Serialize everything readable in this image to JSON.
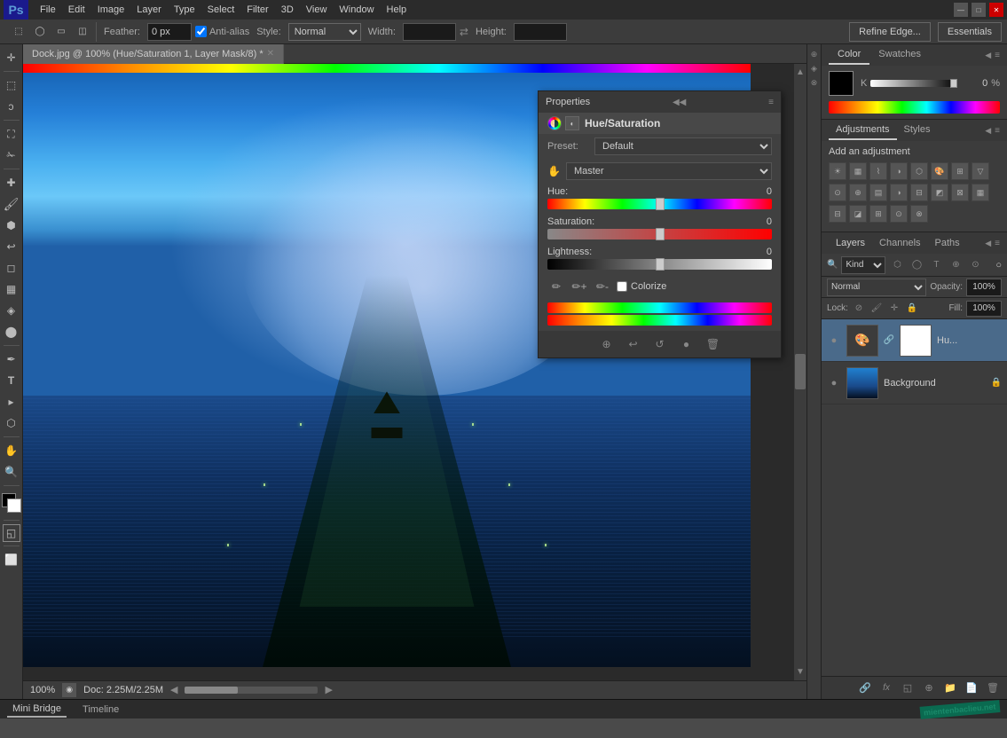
{
  "app": {
    "title": "Adobe Photoshop",
    "logo": "Ps",
    "workspace": "Essentials"
  },
  "menu": {
    "items": [
      "File",
      "Edit",
      "Image",
      "Layer",
      "Type",
      "Select",
      "Filter",
      "3D",
      "View",
      "Window",
      "Help"
    ]
  },
  "toolbar": {
    "feather_label": "Feather:",
    "feather_value": "0 px",
    "anti_alias_label": "Anti-alias",
    "style_label": "Style:",
    "style_value": "Normal",
    "width_label": "Width:",
    "height_label": "Height:",
    "refine_edge": "Refine Edge...",
    "essentials": "Essentials"
  },
  "canvas": {
    "tab_title": "Dock.jpg @ 100% (Hue/Saturation 1, Layer Mask/8) *"
  },
  "properties_panel": {
    "title": "Properties",
    "panel_title": "Hue/Saturation",
    "preset_label": "Preset:",
    "preset_value": "Default",
    "channel_value": "Master",
    "hue_label": "Hue:",
    "hue_value": "0",
    "saturation_label": "Saturation:",
    "saturation_value": "0",
    "lightness_label": "Lightness:",
    "lightness_value": "0",
    "colorize_label": "Colorize"
  },
  "color_panel": {
    "color_tab": "Color",
    "swatches_tab": "Swatches",
    "k_label": "K",
    "k_value": "0",
    "k_percent": "%"
  },
  "adjustments_panel": {
    "adjustments_tab": "Adjustments",
    "styles_tab": "Styles",
    "title": "Add an adjustment"
  },
  "layers_panel": {
    "layers_tab": "Layers",
    "channels_tab": "Channels",
    "paths_tab": "Paths",
    "filter_label": "Kind",
    "blend_mode": "Normal",
    "opacity_label": "Opacity:",
    "opacity_value": "100%",
    "lock_label": "Lock:",
    "fill_label": "Fill:",
    "fill_value": "100%",
    "layers": [
      {
        "name": "Hu...",
        "visible": true,
        "type": "adjustment",
        "has_mask": true
      },
      {
        "name": "Background",
        "visible": true,
        "type": "image",
        "locked": true
      }
    ]
  },
  "status_bar": {
    "zoom": "100%",
    "doc_size": "Doc: 2.25M/2.25M"
  },
  "bottom_bar": {
    "tabs": [
      "Mini Bridge",
      "Timeline"
    ]
  },
  "icons": {
    "move": "✛",
    "select_rect": "⬚",
    "select_lasso": "⚯",
    "crop": "⛶",
    "eyedropper": "🔍",
    "healing": "✚",
    "brush": "🖌",
    "clone": "🔲",
    "eraser": "◻",
    "gradient": "▦",
    "blur": "◈",
    "dodge": "⬤",
    "pen": "✒",
    "text": "T",
    "path_select": "▸",
    "shape": "⬡",
    "hand": "✋",
    "zoom": "🔍",
    "eye": "👁",
    "expand": "◀◀",
    "collapse": "▶▶",
    "menu": "≡",
    "close": "✕",
    "link": "🔗",
    "lock": "🔒",
    "visibility": "●"
  }
}
